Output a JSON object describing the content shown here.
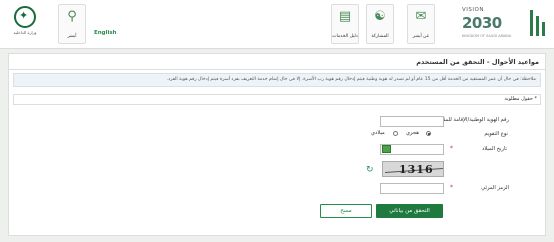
{
  "header": {
    "ministry_logo_text": "وزارة الداخلية",
    "home_label": "أبشر",
    "english_label": "English",
    "services_label": "دليل الخدمات",
    "participation_label": "المشاركة",
    "about_label": "عن أبشر",
    "vision_top": "VISION",
    "vision_year": "2030",
    "vision_sub": "KINGDOM OF SAUDI ARABIA"
  },
  "panel": {
    "title": "مواعيد الأحوال - التحقق من المستخدم",
    "notice": "ملاحظة: في حال أن عمر المستفيد من الخدمة أقل من 15 عام أو لم تصدر له هوية وطنية فيتم إدخال رقم هوية رب الأسرة. إلا في حال إتمام خدمة التعريف بفرد أسرة فيتم إدخال رقم هوية الفرد.",
    "required_fields": "* حقول مطلوبة"
  },
  "form": {
    "id_label": "رقم الهوية الوطنية/الإقامة للمستفيد",
    "calendar_label": "نوع التقويم",
    "hijri_label": "هجري",
    "gregorian_label": "ميلادي",
    "birthdate_label": "تاريخ الميلاد",
    "captcha_text": "1316",
    "code_label": "الرمز المرئي"
  },
  "buttons": {
    "verify": "التحقق من بياناتي",
    "clear": "مسح"
  }
}
